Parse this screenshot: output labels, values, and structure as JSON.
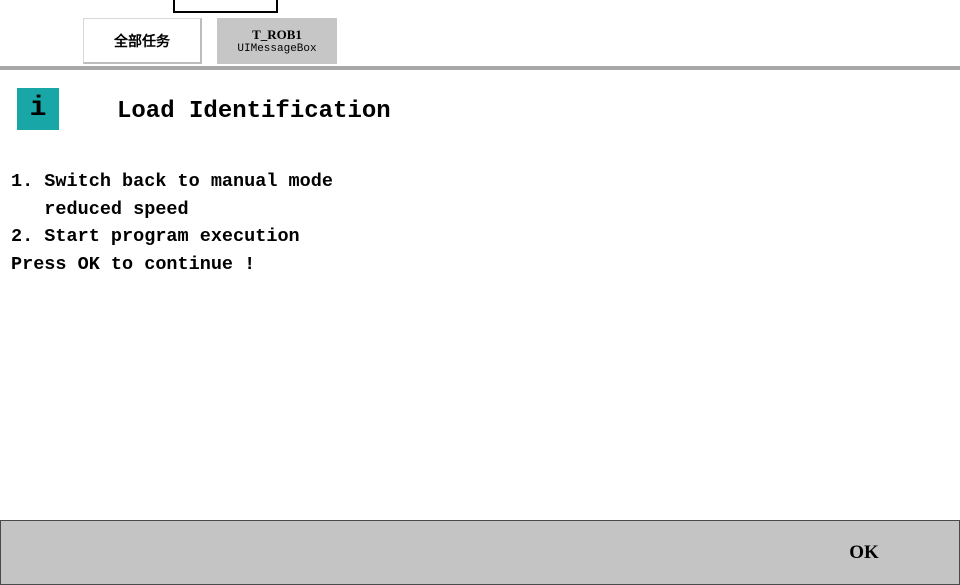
{
  "tabs": {
    "all_tasks": {
      "label": "全部任务"
    },
    "task": {
      "title": "T_ROB1",
      "subtitle": "UIMessageBox"
    }
  },
  "message": {
    "icon": "info-icon",
    "icon_glyph": "i",
    "icon_color": "#18a6a6",
    "title": "Load Identification",
    "lines": [
      "1. Switch back to manual mode",
      "   reduced speed",
      "2. Start program execution",
      "Press OK to continue !"
    ]
  },
  "buttons": {
    "ok_label": "OK"
  }
}
